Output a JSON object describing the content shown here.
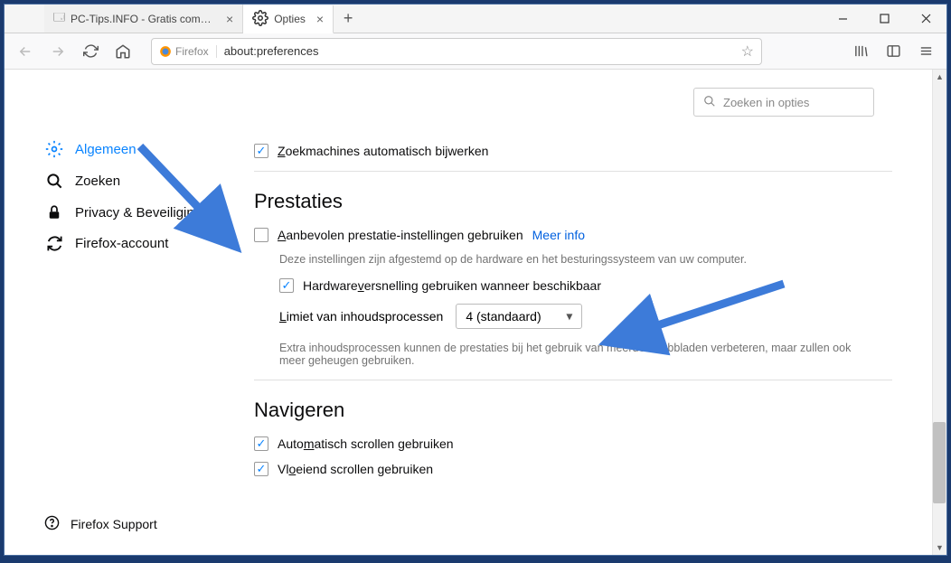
{
  "tabs": [
    {
      "label": "PC-Tips.INFO - Gratis computer tip"
    },
    {
      "label": "Opties"
    }
  ],
  "urlbar": {
    "identity": "Firefox",
    "url": "about:preferences"
  },
  "search": {
    "placeholder": "Zoeken in opties"
  },
  "sidebar": {
    "items": [
      {
        "label": "Algemeen"
      },
      {
        "label": "Zoeken"
      },
      {
        "label": "Privacy & Beveiliging"
      },
      {
        "label": "Firefox-account"
      }
    ],
    "support": "Firefox Support"
  },
  "updates": {
    "search_engines": "Zoekmachines automatisch bijwerken"
  },
  "perf": {
    "heading": "Prestaties",
    "recommended": "Aanbevolen prestatie-instellingen gebruiken",
    "more_info": "Meer info",
    "desc": "Deze instellingen zijn afgestemd op de hardware en het besturingssysteem van uw computer.",
    "hw_accel": "Hardwareversnelling gebruiken wanneer beschikbaar",
    "process_limit_label": "Limiet van inhoudsprocessen",
    "process_limit_value": "4 (standaard)",
    "process_desc": "Extra inhoudsprocessen kunnen de prestaties bij het gebruik van meerdere tabbladen verbeteren, maar zullen ook meer geheugen gebruiken."
  },
  "nav": {
    "heading": "Navigeren",
    "auto_scroll": "Automatisch scrollen gebruiken",
    "smooth_scroll": "Vloeiend scrollen gebruiken"
  }
}
